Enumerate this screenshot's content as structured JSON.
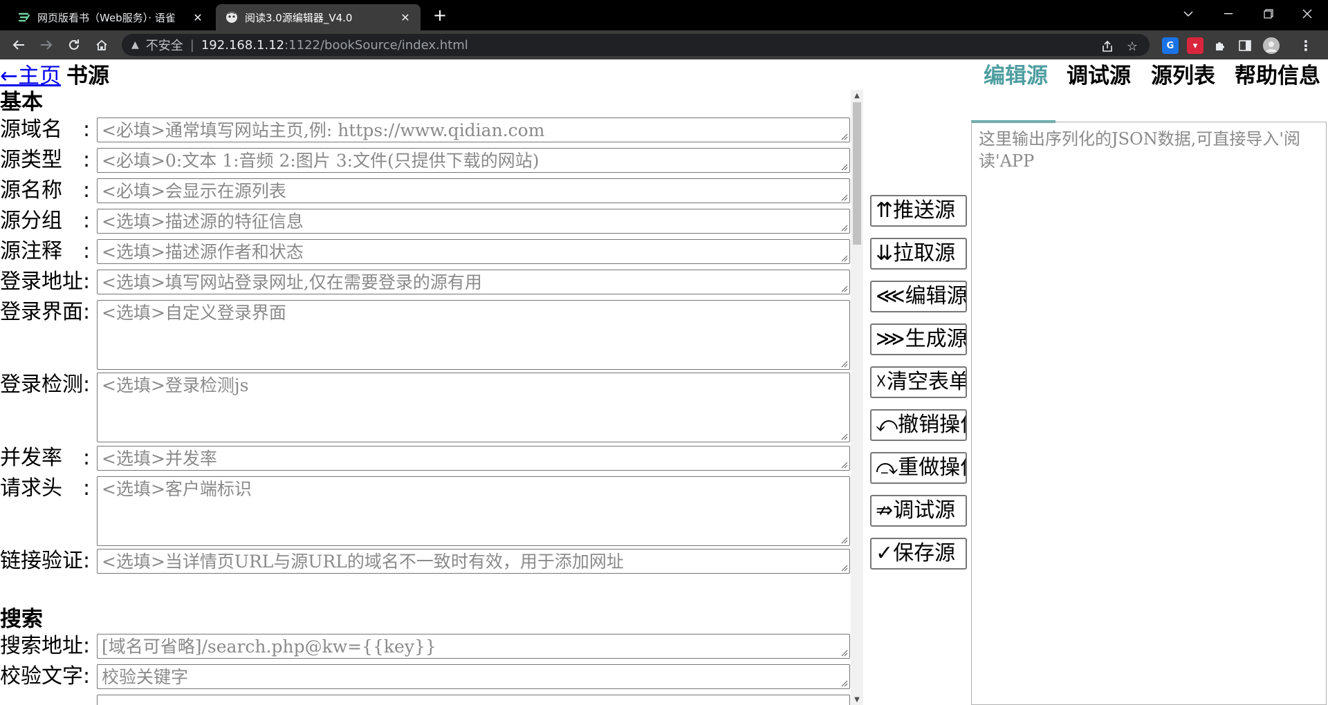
{
  "browser": {
    "tabs": [
      {
        "title": "网页版看书（Web服务）· 语雀",
        "active": false
      },
      {
        "title": "阅读3.0源编辑器_V4.0",
        "active": true
      }
    ],
    "address": {
      "security_label": "不安全",
      "host": "192.168.1.12",
      "path": ":1122/bookSource/index.html"
    }
  },
  "nav": {
    "home_link": "←主页",
    "title": "书源"
  },
  "form": {
    "sections": {
      "basic": "基本",
      "search": "搜索"
    },
    "fields": {
      "source_url": {
        "label": "源域名",
        "placeholder": "<必填>通常填写网站主页,例: https://www.qidian.com"
      },
      "source_type": {
        "label": "源类型",
        "placeholder": "<必填>0:文本 1:音频 2:图片 3:文件(只提供下载的网站)"
      },
      "source_name": {
        "label": "源名称",
        "placeholder": "<必填>会显示在源列表"
      },
      "source_group": {
        "label": "源分组",
        "placeholder": "<选填>描述源的特征信息"
      },
      "source_comment": {
        "label": "源注释",
        "placeholder": "<选填>描述源作者和状态"
      },
      "login_url": {
        "label": "登录地址:",
        "placeholder": "<选填>填写网站登录网址,仅在需要登录的源有用"
      },
      "login_ui": {
        "label": "登录界面:",
        "placeholder": "<选填>自定义登录界面"
      },
      "login_check": {
        "label": "登录检测:",
        "placeholder": "<选填>登录检测js"
      },
      "concurrent_rate": {
        "label": "并发率",
        "placeholder": "<选填>并发率"
      },
      "header": {
        "label": "请求头",
        "placeholder": "<选填>客户端标识"
      },
      "url_pattern": {
        "label": "链接验证:",
        "placeholder": "<选填>当详情页URL与源URL的域名不一致时有效，用于添加网址"
      },
      "search_url": {
        "label": "搜索地址:",
        "placeholder": "[域名可省略]/search.php@kw={{key}}"
      },
      "check_keyword": {
        "label": "校验文字:",
        "placeholder": "校验关键字"
      }
    },
    "colon": ":"
  },
  "actions": {
    "push": "⇈推送源",
    "pull": "⇊拉取源",
    "edit": "⋘编辑源",
    "generate": "⋙生成源",
    "clear": "☓清空表单",
    "undo": "⤺撤销操作",
    "redo": "⤼重做操作",
    "debug": "⇏调试源",
    "save": "✓保存源"
  },
  "right_panel": {
    "tabs": [
      "编辑源",
      "调试源",
      "源列表",
      "帮助信息"
    ],
    "active_tab": "编辑源",
    "json_placeholder": "这里输出序列化的JSON数据,可直接导入'阅读'APP"
  },
  "colors": {
    "active_tab_text": "#4e9ea0",
    "link": "#0000ee",
    "placeholder": "#8a8a8a"
  }
}
